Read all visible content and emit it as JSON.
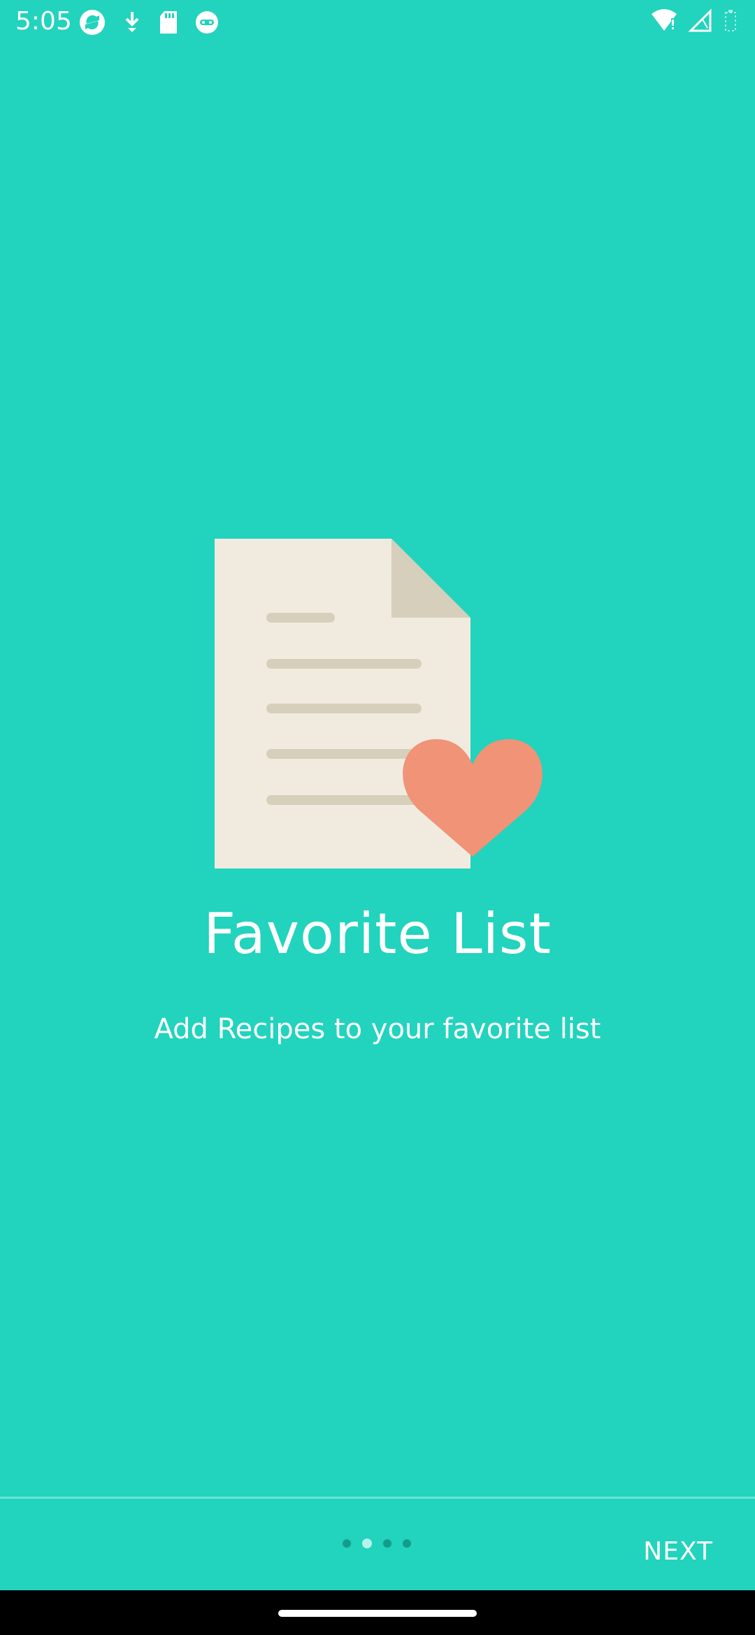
{
  "status_bar": {
    "time": "5:05"
  },
  "onboarding": {
    "title": "Favorite List",
    "subtitle": "Add Recipes to your favorite list",
    "illustration_icon": "document-heart-icon",
    "page_indicator": {
      "total": 4,
      "current": 2
    },
    "next_label": "NEXT"
  },
  "colors": {
    "background": "#22D3BD",
    "paper": "#F1EBDF",
    "paper_lines": "#D5CFBC",
    "heart": "#F09377",
    "dot_inactive": "#139C8B",
    "dot_active": "#B8F3EA"
  }
}
